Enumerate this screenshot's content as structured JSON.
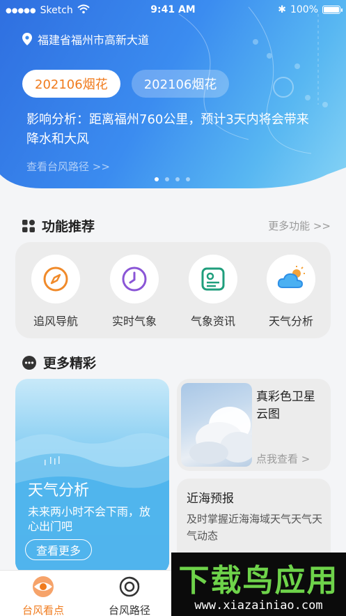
{
  "status_bar": {
    "carrier": "Sketch",
    "time": "9:41 AM",
    "battery": "100%"
  },
  "header": {
    "location": "福建省福州市高新大道",
    "tabs": [
      {
        "label": "202106烟花",
        "active": true
      },
      {
        "label": "202106烟花",
        "active": false
      }
    ],
    "impact_text": "影响分析：距离福州760公里，预计3天内将会带来降水和大风",
    "route_link": "查看台风路径 >>",
    "carousel": {
      "count": 4,
      "active_index": 0
    }
  },
  "features": {
    "title": "功能推荐",
    "more": "更多功能 >>",
    "items": [
      {
        "label": "追风导航",
        "icon": "compass-icon",
        "color": "#f08a2a"
      },
      {
        "label": "实时气象",
        "icon": "clock-icon",
        "color": "#8a55d6"
      },
      {
        "label": "气象资讯",
        "icon": "news-icon",
        "color": "#1f9e7c"
      },
      {
        "label": "天气分析",
        "icon": "sun-cloud-icon",
        "color": "#2e8fe6"
      }
    ]
  },
  "highlights": {
    "title": "更多精彩",
    "weather_card": {
      "title": "天气分析",
      "desc": "未来两小时不会下雨，放心出门吧",
      "button": "查看更多"
    },
    "satellite_card": {
      "title": "真彩色卫星云图",
      "link": "点我查看 >"
    },
    "sea_card": {
      "title": "近海预报",
      "desc": "及时掌握近海海域天气天气天气动态"
    }
  },
  "bottom_nav": {
    "items": [
      {
        "label": "台风看点",
        "active": true
      },
      {
        "label": "台风路径",
        "active": false
      }
    ]
  },
  "watermark": {
    "brand": "下载鸟应用",
    "url": "www.xiazainiao.com"
  },
  "colors": {
    "accent": "#f07b1d",
    "header_blue": "#3b8cf0"
  }
}
